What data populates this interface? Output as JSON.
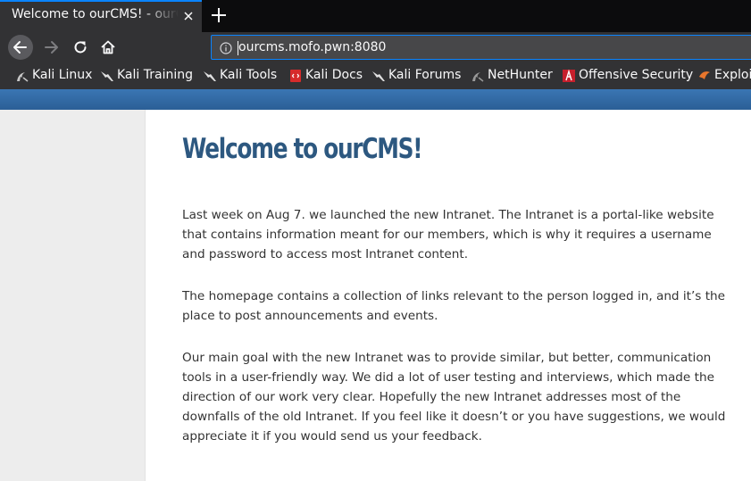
{
  "browser": {
    "tab": {
      "title": "Welcome to ourCMS! - ourCMS"
    },
    "url": "ourcms.mofo.pwn:8080",
    "bookmarks": [
      {
        "label": "Kali Linux",
        "icon": "kali-dragon-icon"
      },
      {
        "label": "Kali Training",
        "icon": "kali-dragon-icon"
      },
      {
        "label": "Kali Tools",
        "icon": "kali-dragon-icon"
      },
      {
        "label": "Kali Docs",
        "icon": "kali-docs-icon"
      },
      {
        "label": "Kali Forums",
        "icon": "kali-dragon-icon"
      },
      {
        "label": "NetHunter",
        "icon": "nethunter-icon"
      },
      {
        "label": "Offensive Security",
        "icon": "offensive-security-icon"
      },
      {
        "label": "Exploit-DB",
        "icon": "exploit-db-icon"
      }
    ]
  },
  "page": {
    "title": "Welcome to ourCMS!",
    "paragraphs": [
      "Last week on Aug 7. we launched the new Intranet. The Intranet is a portal-like website that contains information meant for our members, which is why it requires a username and password to access most Intranet content.",
      "The homepage contains a collection of links relevant to the person logged in, and it’s the place to post announcements and events.",
      "Our main goal with the new Intranet was to provide similar, but better, communication tools in a user-friendly way. We did a lot of user testing and interviews, which made the direction of our work very clear. Hopefully the new Intranet addresses most of the downfalls of the old Intranet. If you feel like it doesn’t or you have suggestions, we would appreciate it if you would send us your feedback."
    ]
  },
  "colors": {
    "accent": "#0a84ff",
    "banner": "#2e6aa8",
    "title": "#2d5880"
  }
}
